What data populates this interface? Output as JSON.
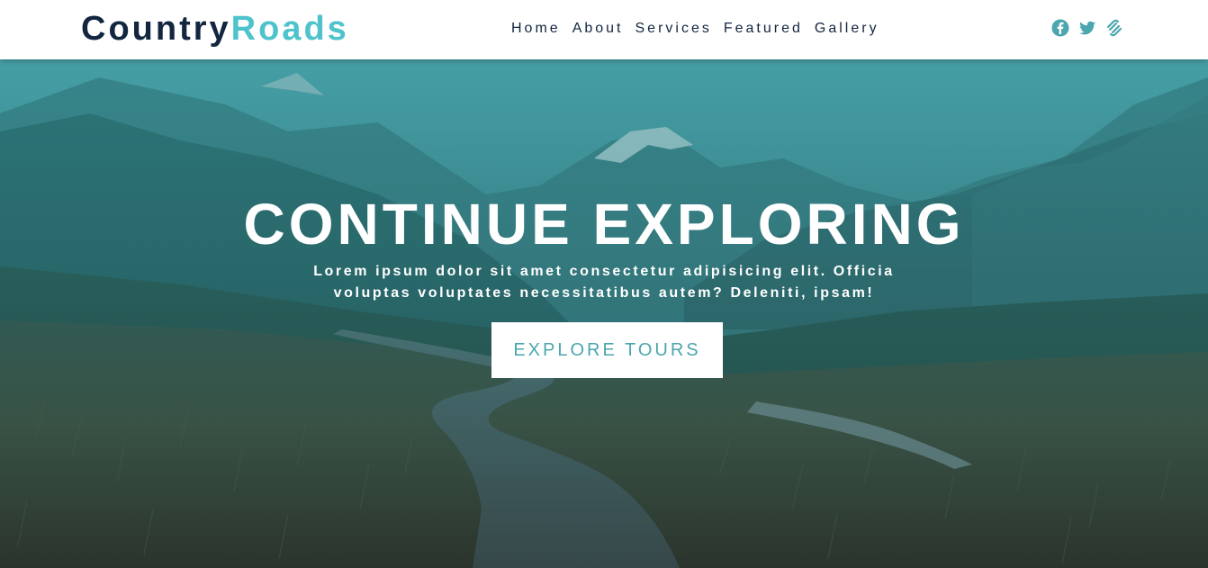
{
  "brand": {
    "part1": "Country",
    "part2": "Roads"
  },
  "nav": {
    "items": [
      {
        "label": "Home"
      },
      {
        "label": "About"
      },
      {
        "label": "Services"
      },
      {
        "label": "Featured"
      },
      {
        "label": "Gallery"
      }
    ]
  },
  "social": [
    {
      "icon": "facebook-icon"
    },
    {
      "icon": "twitter-icon"
    },
    {
      "icon": "squarespace-icon"
    }
  ],
  "hero": {
    "title": "CONTINUE EXPLORING",
    "subtitle_line1": "Lorem ipsum dolor sit amet consectetur adipisicing elit. Officia",
    "subtitle_line2": "voluptas voluptates necessitatibus autem? Deleniti, ipsam!",
    "cta_label": "EXPLORE TOURS"
  },
  "colors": {
    "brand_dark": "#13263f",
    "brand_accent": "#4ec3cb",
    "overlay": "#2a8a92",
    "button_text": "#4ba6ae"
  }
}
